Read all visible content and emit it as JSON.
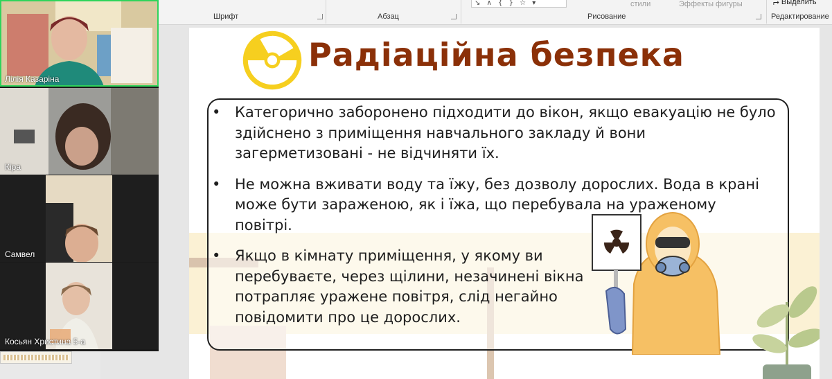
{
  "ribbon": {
    "font_group": "Шрифт",
    "paragraph_group": "Абзац",
    "drawing_group": "Рисование",
    "editing_group": "Редактирование",
    "styles_label": "стили",
    "shape_effects_label": "Эффекты фигуры",
    "select_label": "Выделить"
  },
  "participants": [
    {
      "name": "Лілія Казаріна",
      "active": true
    },
    {
      "name": "Кіра",
      "active": false
    },
    {
      "name": "Самвел",
      "active": false
    },
    {
      "name": "Косьян Христина 5-а",
      "active": false
    }
  ],
  "slide": {
    "title": "Радіаційна безпека",
    "bullets": [
      " Категорично заборонено підходити до вікон, якщо евакуацію не було здійснено з приміщення навчального закладу й вони загерметизовані - не відчиняти їх.",
      "Не можна вживати воду та їжу, без  дозволу дорослих. Вода в крані може бути зараженою, як і їжа, що перебувала на ураженому повітрі.",
      "Якщо в кімнату приміщення, у якому ви перебуваєте, через щілини, незачинені вікна потрапляє уражене повітря, слід негайно повідомити про це дорослих."
    ],
    "icons": [
      "radiation-hazard-icon",
      "hazmat-person-illustration",
      "plant-illustration"
    ]
  },
  "colors": {
    "title": "#8b3008",
    "radiation_yellow": "#f6cf1f",
    "hazmat_suit": "#f6c064",
    "active_speaker": "#2fd45b"
  }
}
